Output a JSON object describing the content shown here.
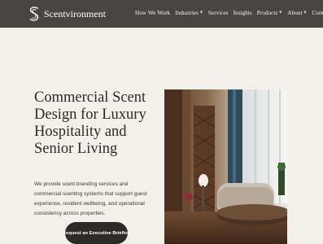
{
  "brand": {
    "name": "Scentvironment",
    "logo_icon": "s-monogram-icon"
  },
  "nav": {
    "items": [
      {
        "label": "How We Work",
        "dropdown": false
      },
      {
        "label": "Industries",
        "dropdown": true
      },
      {
        "label": "Services",
        "dropdown": false
      },
      {
        "label": "Insights",
        "dropdown": false
      },
      {
        "label": "Products",
        "dropdown": true
      },
      {
        "label": "About",
        "dropdown": true
      },
      {
        "label": "Contact",
        "dropdown": false
      }
    ]
  },
  "hero": {
    "title": "Commercial Scent Design for Luxury Hospitality and Senior Living",
    "description": "We provide scent branding services and commercial scenting systems that support guest experience, resident wellbeing, and operational consistency across properties.",
    "cta_label": "Request an Executive Briefing"
  },
  "colors": {
    "nav_bg": "#4a4541",
    "page_bg": "#f3f0ea",
    "cta_bg": "#2e2a27",
    "text_dark": "#2d2b29"
  }
}
